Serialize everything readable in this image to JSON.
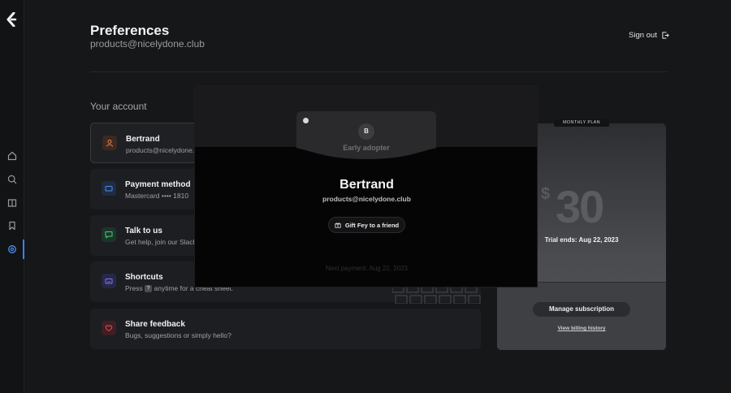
{
  "header": {
    "title": "Preferences",
    "email": "products@nicelydone.club",
    "sign_out": "Sign out"
  },
  "section": {
    "title": "Your account"
  },
  "cards": [
    {
      "title": "Bertrand",
      "subtitle": "products@nicelydone.club",
      "icon": "user-icon",
      "color": "#e9824f"
    },
    {
      "title": "Payment method",
      "subtitle": "Mastercard •••• 1810",
      "icon": "credit-card-icon",
      "color": "#4f8ef0"
    },
    {
      "title": "Talk to us",
      "subtitle": "Get help, join our Slack",
      "icon": "chat-icon",
      "color": "#3fcf7c"
    },
    {
      "title": "Shortcuts",
      "subtitle_pre": "Press",
      "subtitle_key": "?",
      "subtitle_post": "anytime for a cheat sheet.",
      "icon": "keyboard-icon",
      "color": "#7d7bf0"
    },
    {
      "title": "Share feedback",
      "subtitle": "Bugs, suggestions or simply hello?",
      "icon": "heart-icon",
      "color": "#e5484d"
    }
  ],
  "plan": {
    "badge": "MONTHLY PLAN",
    "currency": "$",
    "price": "30",
    "trial": "Trial ends: Aug 22, 2023",
    "manage": "Manage subscription",
    "billing": "View billing history"
  },
  "modal": {
    "card_label": "Early adopter",
    "avatar_letter": "B",
    "name": "Bertrand",
    "email": "products@nicelydone.club",
    "gift_button": "Gift Fey to a friend",
    "next_payment": "Next payment: Aug 22, 2023"
  },
  "nav": [
    "home-icon",
    "search-icon",
    "book-icon",
    "bookmark-icon",
    "settings-icon"
  ],
  "colors": {
    "accent": "#3b82f6",
    "background": "#161719"
  }
}
